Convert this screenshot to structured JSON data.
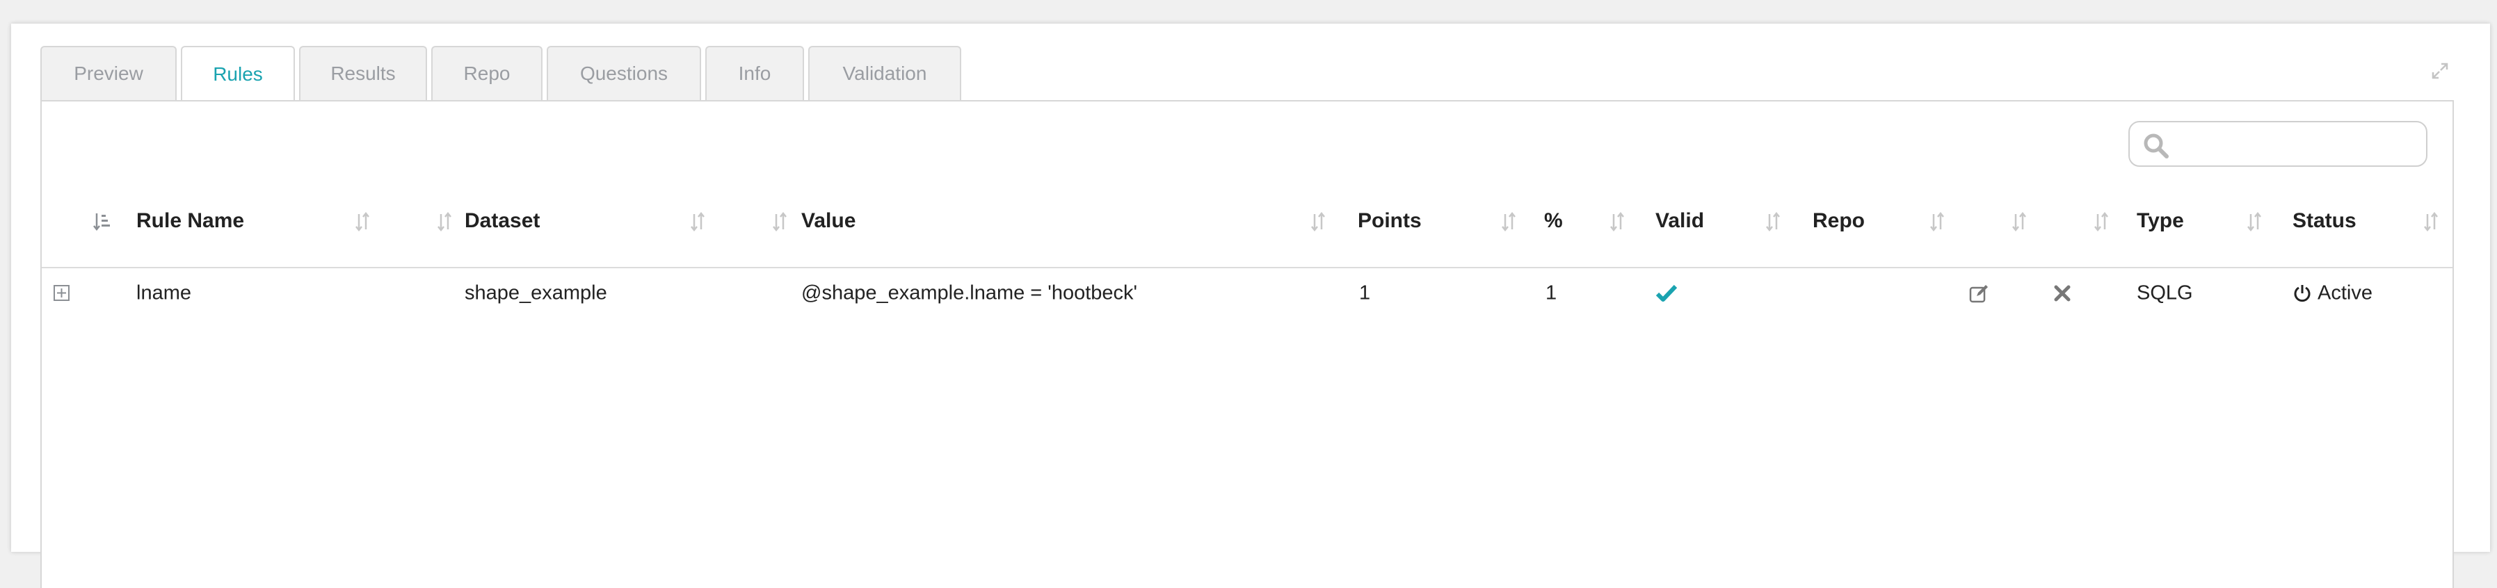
{
  "tabs": [
    {
      "label": "Preview",
      "active": false
    },
    {
      "label": "Rules",
      "active": true
    },
    {
      "label": "Results",
      "active": false
    },
    {
      "label": "Repo",
      "active": false
    },
    {
      "label": "Questions",
      "active": false
    },
    {
      "label": "Info",
      "active": false
    },
    {
      "label": "Validation",
      "active": false
    }
  ],
  "search": {
    "value": "",
    "placeholder": ""
  },
  "columns": {
    "rule_name": "Rule Name",
    "dataset": "Dataset",
    "value": "Value",
    "points": "Points",
    "percent": "%",
    "valid": "Valid",
    "repo": "Repo",
    "type": "Type",
    "status": "Status"
  },
  "rows": [
    {
      "rule_name": "lname",
      "dataset": "shape_example",
      "value": "@shape_example.lname = 'hootbeck'",
      "points": "1",
      "percent": "1",
      "valid": true,
      "repo": "",
      "type": "SQLG",
      "status": "Active"
    }
  ],
  "colors": {
    "accent": "#1aa3b0",
    "tab_inactive_text": "#9a9da2",
    "valid_check": "#1aa3b0"
  },
  "icons": [
    "expand-icon",
    "search-icon",
    "sort-icon",
    "expand-row-icon",
    "check-icon",
    "edit-icon",
    "delete-icon",
    "power-icon"
  ]
}
